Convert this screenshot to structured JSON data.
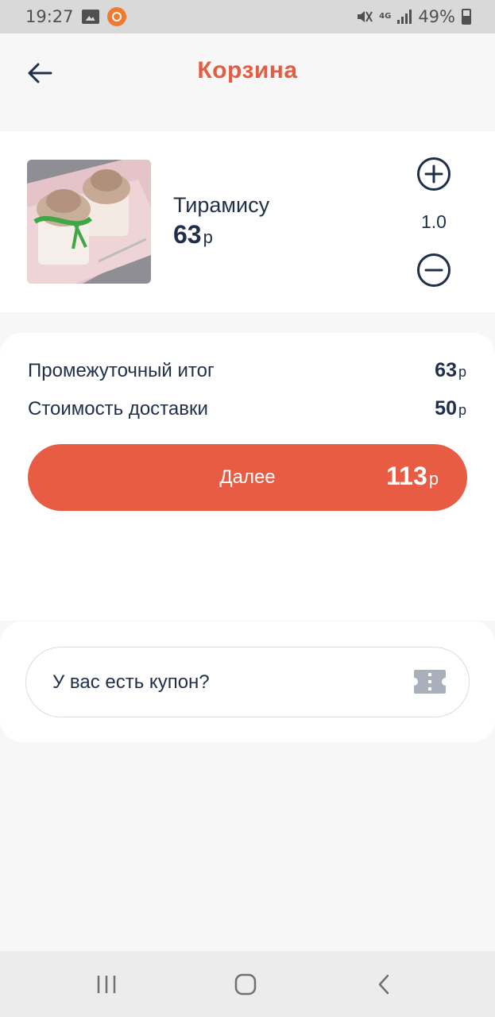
{
  "status_bar": {
    "time": "19:27",
    "network": "4G",
    "battery": "49%"
  },
  "header": {
    "title": "Корзина",
    "back_icon": "arrow-left-icon"
  },
  "cart": {
    "items": [
      {
        "name": "Тирамису",
        "price": "63",
        "currency": "р",
        "quantity": "1.0"
      }
    ]
  },
  "summary": {
    "subtotal_label": "Промежуточный итог",
    "subtotal_value": "63",
    "delivery_label": "Стоимость доставки",
    "delivery_value": "50",
    "currency": "р",
    "next_label": "Далее",
    "total_value": "113"
  },
  "coupon": {
    "prompt": "У вас есть купон?",
    "icon": "ticket-icon"
  },
  "colors": {
    "accent": "#e85c44",
    "title": "#e35d44",
    "text": "#1f2f4a",
    "background": "#f7f7f7"
  }
}
